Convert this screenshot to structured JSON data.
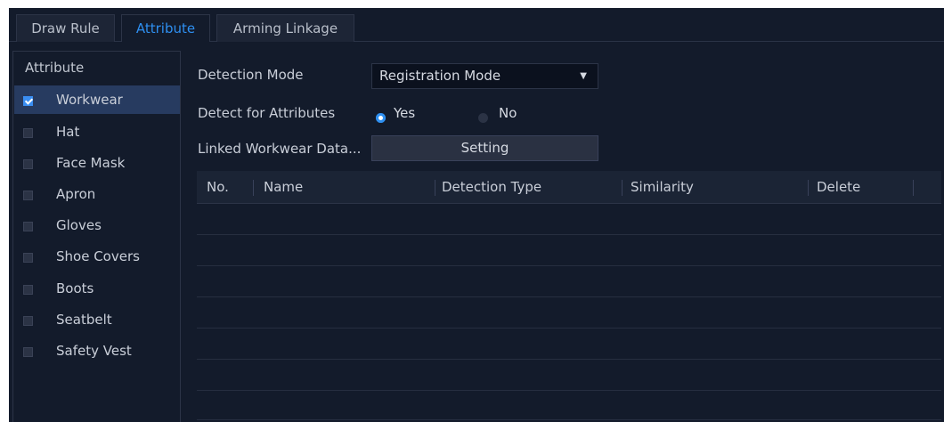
{
  "tabs": [
    {
      "label": "Draw Rule"
    },
    {
      "label": "Attribute"
    },
    {
      "label": "Arming Linkage"
    }
  ],
  "active_tab": "Attribute",
  "attribute_panel": {
    "title": "Attribute",
    "items": [
      {
        "label": "Workwear",
        "checked": true
      },
      {
        "label": "Hat",
        "checked": false
      },
      {
        "label": "Face Mask",
        "checked": false
      },
      {
        "label": "Apron",
        "checked": false
      },
      {
        "label": "Gloves",
        "checked": false
      },
      {
        "label": "Shoe Covers",
        "checked": false
      },
      {
        "label": "Boots",
        "checked": false
      },
      {
        "label": "Seatbelt",
        "checked": false
      },
      {
        "label": "Safety Vest",
        "checked": false
      }
    ]
  },
  "form": {
    "detection_mode_label": "Detection Mode",
    "detection_mode_value": "Registration Mode",
    "detect_attributes_label": "Detect for Attributes",
    "yes_label": "Yes",
    "no_label": "No",
    "detect_attributes_value": "Yes",
    "linked_data_label": "Linked Workwear Data...",
    "setting_button": "Setting"
  },
  "table": {
    "columns": [
      "No.",
      "Name",
      "Detection Type",
      "Similarity",
      "Delete"
    ],
    "rows": []
  },
  "colors": {
    "accent": "#2e8ff0",
    "background": "#131b2b",
    "selected_row": "#273b60"
  }
}
